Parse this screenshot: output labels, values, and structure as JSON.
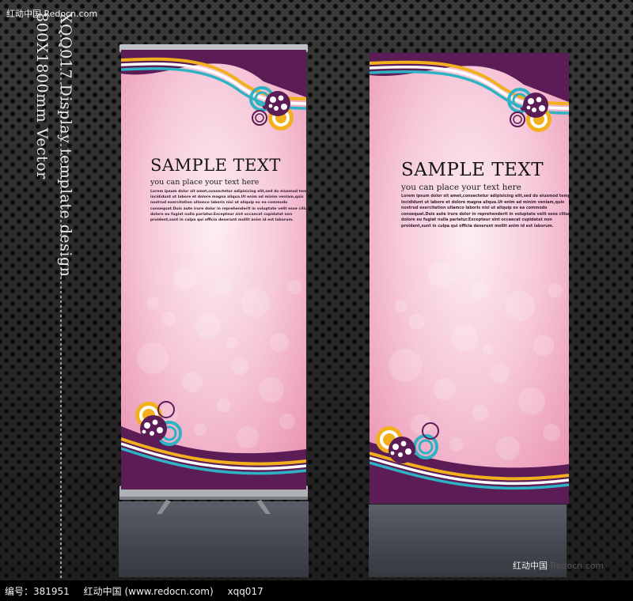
{
  "watermark_top": "红动中国 Redocn.com",
  "side_caption": {
    "line1": "XQQ017 Display template design",
    "line2": "800X1800mm Vector"
  },
  "banner_left": {
    "title": "SAMPLE TEXT",
    "subtitle": "you can place your text here",
    "body_lines": [
      "Lorem ipsum dolor sit amet,consectetur adipisicing elit,sed do eiusmod tempor",
      "incididunt ut labore et dolore magna aliqua.Ut enim ad minim veniam,quis",
      "nostrud exercitation ullamco laboris nisi ut aliquip ex ea commodo",
      "consequat.Duis aute irure dolor in reprehenderit in voluptate velit esse cillum",
      "dolore eu fugiat nulla pariatur.Excepteur sint occaecat cupidatat non",
      "proident,sunt in culpa qui officia deserunt mollit anim id est laborum."
    ]
  },
  "banner_right": {
    "title": "SAMPLE TEXT",
    "subtitle": "you can place your text here",
    "body_lines": [
      "Lorem ipsum dolor sit amet,consectetur adipisicing elit,sed do eiusmod tempor",
      "incididunt ut labore et dolore magna aliqua.Ut enim ad minim veniam,quis",
      "nostrud exercitation ullamco laboris nisi ut aliquip ex ea commodo",
      "consequat.Duis aute irure dolor in reprehenderit in voluptate velit esse cillum",
      "dolore eu fugiat nulla pariatur.Excepteur sint occaecat cupidatat non",
      "proident,sunt in culpa qui officia deserunt mollit anim id est laborum."
    ]
  },
  "watermark_bottom": {
    "brand": "红动中国",
    "site": "Redocn.com"
  },
  "footer": {
    "id_label": "编号：381951",
    "site": "红动中国 (www.redocn.com)",
    "code": "xqq017"
  },
  "colors": {
    "banner_pink": "#f6c7d8",
    "purple": "#5c1d57",
    "teal": "#2fb3c4",
    "yellow": "#f2b01e",
    "background": "#2b2b2b"
  }
}
